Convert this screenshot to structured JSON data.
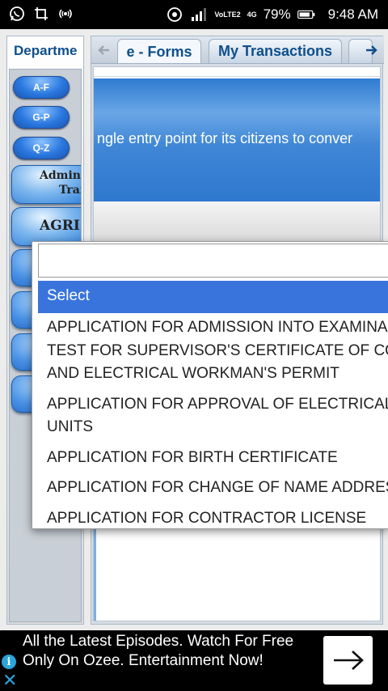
{
  "status_bar": {
    "volte": "VoLTE2",
    "network": "4G",
    "battery": "79%",
    "time": "9:48 AM"
  },
  "dept_panel": {
    "title": "Departme",
    "range_buttons": [
      "A-F",
      "G-P",
      "Q-Z"
    ],
    "admin_line1": "Admin",
    "admin_line2": "Trai",
    "agri_label": "AGRI"
  },
  "tabs": {
    "items": [
      "e - Forms",
      "My Transactions"
    ],
    "active": "e - Forms"
  },
  "banner": {
    "text": "ngle entry point for its citizens to conver"
  },
  "dropdown": {
    "search_value": "",
    "options": [
      "Select",
      "APPLICATION FOR ADMISSION INTO EXAMINA",
      "TEST FOR SUPERVISOR'S CERTIFICATE OF CON",
      "AND ELECTRICAL WORKMAN'S PERMIT",
      "APPLICATION FOR APPROVAL OF ELECTRICAL",
      "UNITS",
      "APPLICATION FOR BIRTH CERTIFICATE",
      "APPLICATION FOR CHANGE OF NAME ADDRES",
      "APPLICATION FOR CONTRACTOR LICENSE"
    ],
    "selected": "Select"
  },
  "ad": {
    "text": "All the Latest Episodes. Watch For Free Only On Ozee. Entertainment Now!"
  },
  "colors": {
    "accent_blue": "#3874dc",
    "tab_text": "#0e4f8c",
    "ad_icon": "#2aa4d9"
  }
}
